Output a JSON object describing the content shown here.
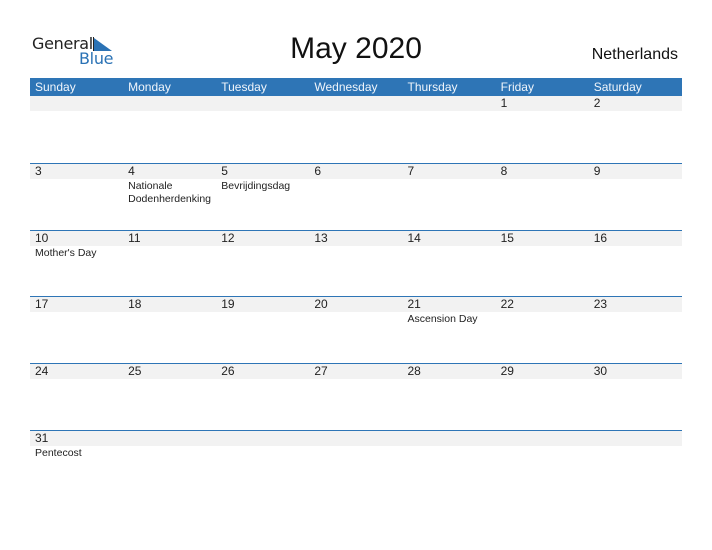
{
  "logo": {
    "word1": "General",
    "word2": "Blue"
  },
  "title": "May 2020",
  "country": "Netherlands",
  "colors": {
    "accent": "#2e75b6",
    "date_band": "#f2f2f2"
  },
  "weekdays": [
    "Sunday",
    "Monday",
    "Tuesday",
    "Wednesday",
    "Thursday",
    "Friday",
    "Saturday"
  ],
  "weeks": [
    [
      {
        "d": ""
      },
      {
        "d": ""
      },
      {
        "d": ""
      },
      {
        "d": ""
      },
      {
        "d": ""
      },
      {
        "d": "1"
      },
      {
        "d": "2"
      }
    ],
    [
      {
        "d": "3"
      },
      {
        "d": "4",
        "h": "Nationale Dodenherdenking"
      },
      {
        "d": "5",
        "h": "Bevrijdingsdag"
      },
      {
        "d": "6"
      },
      {
        "d": "7"
      },
      {
        "d": "8"
      },
      {
        "d": "9"
      }
    ],
    [
      {
        "d": "10",
        "h": "Mother's Day"
      },
      {
        "d": "11"
      },
      {
        "d": "12"
      },
      {
        "d": "13"
      },
      {
        "d": "14"
      },
      {
        "d": "15"
      },
      {
        "d": "16"
      }
    ],
    [
      {
        "d": "17"
      },
      {
        "d": "18"
      },
      {
        "d": "19"
      },
      {
        "d": "20"
      },
      {
        "d": "21",
        "h": "Ascension Day"
      },
      {
        "d": "22"
      },
      {
        "d": "23"
      }
    ],
    [
      {
        "d": "24"
      },
      {
        "d": "25"
      },
      {
        "d": "26"
      },
      {
        "d": "27"
      },
      {
        "d": "28"
      },
      {
        "d": "29"
      },
      {
        "d": "30"
      }
    ],
    [
      {
        "d": "31",
        "h": "Pentecost"
      },
      {
        "d": ""
      },
      {
        "d": ""
      },
      {
        "d": ""
      },
      {
        "d": ""
      },
      {
        "d": ""
      },
      {
        "d": ""
      }
    ]
  ]
}
